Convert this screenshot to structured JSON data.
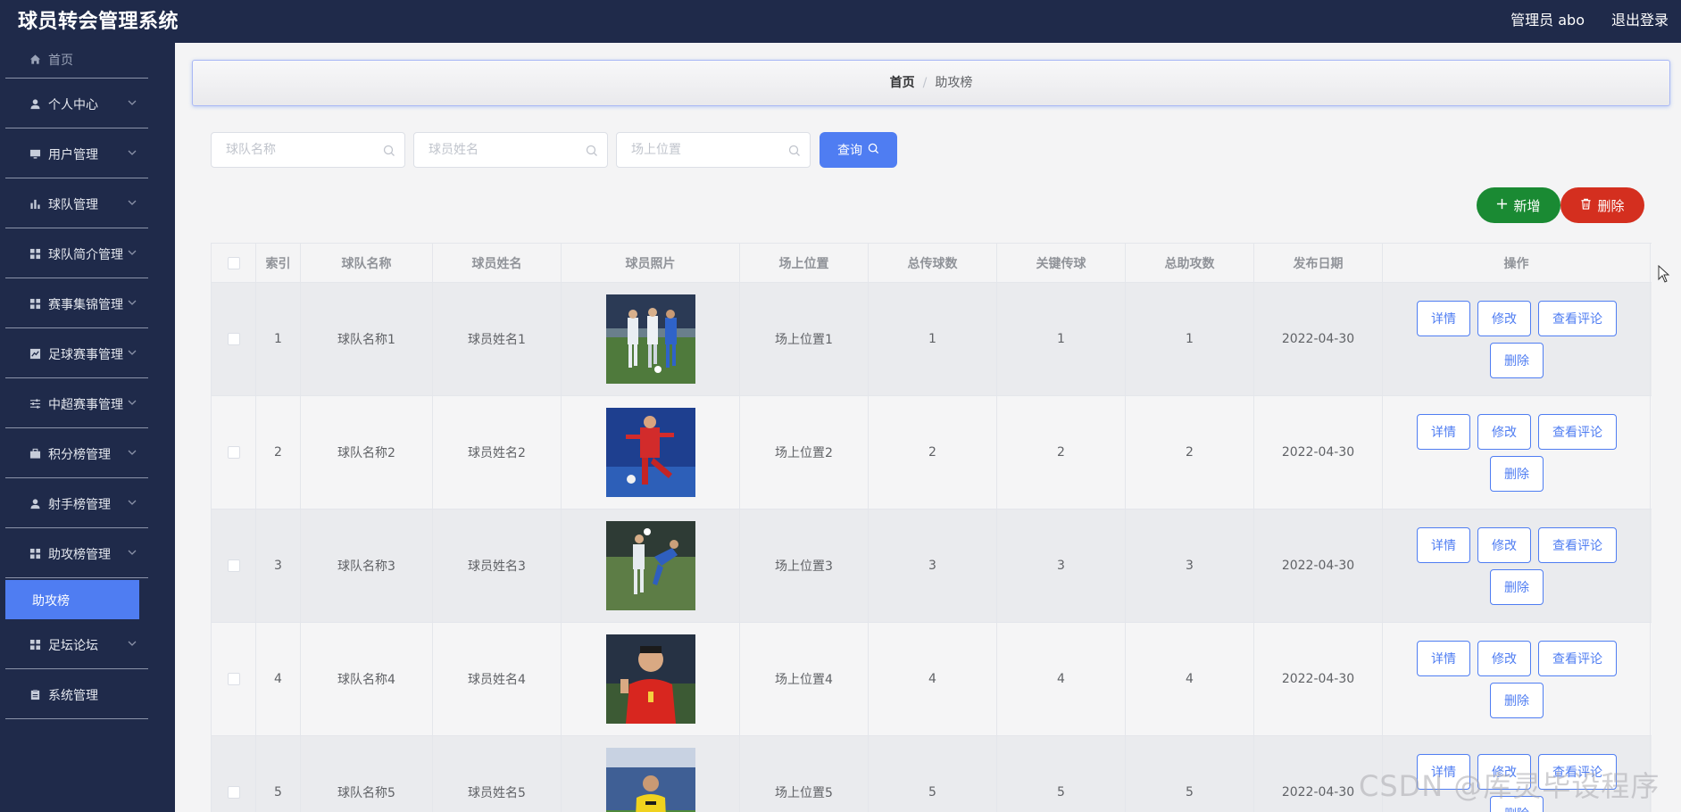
{
  "app": {
    "title": "球员转会管理系统",
    "user": "管理员 abo",
    "logout": "退出登录"
  },
  "sidebar": {
    "items": [
      {
        "label": "首页",
        "icon": "home-icon"
      },
      {
        "label": "个人中心",
        "icon": "user-icon"
      },
      {
        "label": "用户管理",
        "icon": "monitor-icon"
      },
      {
        "label": "球队管理",
        "icon": "bar-chart-icon"
      },
      {
        "label": "球队简介管理",
        "icon": "grid-icon"
      },
      {
        "label": "赛事集锦管理",
        "icon": "grid-icon"
      },
      {
        "label": "足球赛事管理",
        "icon": "chart-box-icon"
      },
      {
        "label": "中超赛事管理",
        "icon": "sliders-icon"
      },
      {
        "label": "积分榜管理",
        "icon": "briefcase-icon"
      },
      {
        "label": "射手榜管理",
        "icon": "user-icon"
      },
      {
        "label": "助攻榜管理",
        "icon": "grid-icon"
      },
      {
        "label": "足坛论坛",
        "icon": "grid-icon"
      },
      {
        "label": "系统管理",
        "icon": "clipboard-icon"
      }
    ],
    "active_sub": "助攻榜"
  },
  "breadcrumb": {
    "home": "首页",
    "separator": "/",
    "current": "助攻榜"
  },
  "search": {
    "team_placeholder": "球队名称",
    "player_placeholder": "球员姓名",
    "position_placeholder": "场上位置",
    "query_label": "查询"
  },
  "actions": {
    "add_label": "新增",
    "delete_label": "删除"
  },
  "table": {
    "columns": [
      "索引",
      "球队名称",
      "球员姓名",
      "球员照片",
      "场上位置",
      "总传球数",
      "关键传球",
      "总助攻数",
      "发布日期",
      "操作"
    ],
    "rows": [
      {
        "index": "1",
        "team": "球队名称1",
        "player": "球员姓名1",
        "position": "场上位置1",
        "passes": "1",
        "key_passes": "1",
        "assists": "1",
        "date": "2022-04-30"
      },
      {
        "index": "2",
        "team": "球队名称2",
        "player": "球员姓名2",
        "position": "场上位置2",
        "passes": "2",
        "key_passes": "2",
        "assists": "2",
        "date": "2022-04-30"
      },
      {
        "index": "3",
        "team": "球队名称3",
        "player": "球员姓名3",
        "position": "场上位置3",
        "passes": "3",
        "key_passes": "3",
        "assists": "3",
        "date": "2022-04-30"
      },
      {
        "index": "4",
        "team": "球队名称4",
        "player": "球员姓名4",
        "position": "场上位置4",
        "passes": "4",
        "key_passes": "4",
        "assists": "4",
        "date": "2022-04-30"
      },
      {
        "index": "5",
        "team": "球队名称5",
        "player": "球员姓名5",
        "position": "场上位置5",
        "passes": "5",
        "key_passes": "5",
        "assists": "5",
        "date": "2022-04-30"
      }
    ],
    "row_actions": {
      "detail": "详情",
      "edit": "修改",
      "comments": "查看评论",
      "delete": "删除"
    }
  },
  "watermark": "CSDN @库灵毕设程序",
  "colors": {
    "sidebar_bg": "#1f2a4a",
    "primary": "#4f7df2",
    "success": "#1a8a33",
    "danger": "#d42f1f"
  }
}
